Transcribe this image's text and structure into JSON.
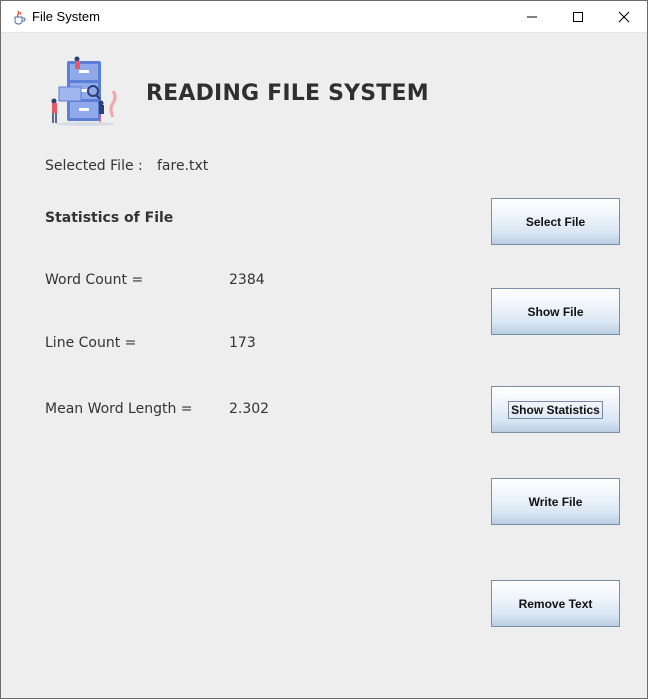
{
  "window": {
    "title": "File System"
  },
  "header": {
    "title": "READING FILE SYSTEM"
  },
  "selected_file": {
    "label": "Selected File :",
    "value": "fare.txt"
  },
  "statistics": {
    "heading": "Statistics of File",
    "word_count": {
      "label": "Word Count =",
      "value": "2384"
    },
    "line_count": {
      "label": "Line Count =",
      "value": "173"
    },
    "mean_word_length": {
      "label": "Mean Word Length =",
      "value": "2.302"
    }
  },
  "buttons": {
    "select_file": "Select File",
    "show_file": "Show File",
    "show_statistics": "Show Statistics",
    "write_file": "Write File",
    "remove_text": "Remove Text"
  },
  "colors": {
    "window_bg": "#eeeeee",
    "button_border": "#7a8ea6",
    "button_gradient_bottom": "#b9cde2",
    "heading_text": "#2f2f2f"
  },
  "icons": {
    "app": "java-cup-icon",
    "logo": "file-cabinet-illustration",
    "minimize": "minimize-icon",
    "maximize": "maximize-icon",
    "close": "close-icon"
  }
}
